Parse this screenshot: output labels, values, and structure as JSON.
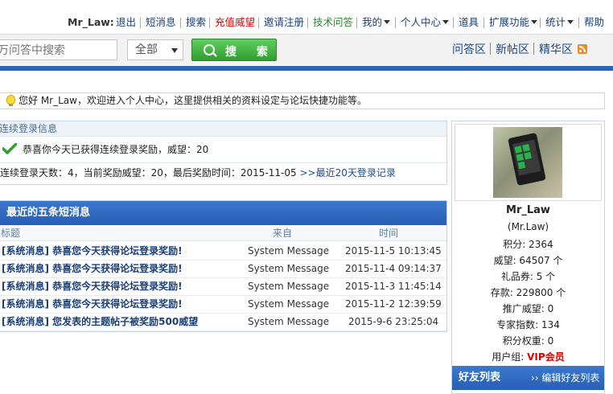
{
  "topnav": {
    "username": "Mr_Law:",
    "items": [
      {
        "label": "退出",
        "color": "#1a3f75"
      },
      {
        "label": "短消息",
        "color": "#1a3f75"
      },
      {
        "label": "搜索",
        "color": "#1a3f75"
      },
      {
        "label": "充值威望",
        "color": "#e00000"
      },
      {
        "label": "邀请注册",
        "color": "#1a3f75"
      },
      {
        "label": "技术问答",
        "color": "#2a8a2a"
      },
      {
        "label": "我的",
        "color": "#1a3f75"
      },
      {
        "label": "个人中心",
        "color": "#1a3f75"
      },
      {
        "label": "道具",
        "color": "#1a3f75"
      },
      {
        "label": "扩展功能",
        "color": "#1a3f75"
      },
      {
        "label": "统计",
        "color": "#1a3f75"
      },
      {
        "label": "帮助",
        "color": "#1a3f75"
      }
    ]
  },
  "search": {
    "placeholder": "万问答中搜索",
    "scope": "全部",
    "button": "搜 索"
  },
  "zones": [
    "问答区",
    "新帖区",
    "精华区"
  ],
  "welcome": "您好 Mr_Law，欢迎进入个人中心，这里提供相关的资料设定与论坛快捷功能等。",
  "login": {
    "title": "连续登录信息",
    "message": "恭喜你今天已获得连续登录奖励，威望：20",
    "stats": "连续登录天数：4，当前奖励威望：20，最后奖励时间：2015-11-05 ",
    "link": ">>最近20天登录记录"
  },
  "messages": {
    "title": "最近的五条短消息",
    "columns": {
      "subject": "标题",
      "from": "来自",
      "time": "时间"
    },
    "rows": [
      {
        "subject": "[系统消息] 恭喜您今天获得论坛登录奖励!",
        "from": "System Message",
        "time": "2015-11-5 10:13:45"
      },
      {
        "subject": "[系统消息] 恭喜您今天获得论坛登录奖励!",
        "from": "System Message",
        "time": "2015-11-4 09:14:37"
      },
      {
        "subject": "[系统消息] 恭喜您今天获得论坛登录奖励!",
        "from": "System Message",
        "time": "2015-11-3 11:45:14"
      },
      {
        "subject": "[系统消息] 恭喜您今天获得论坛登录奖励!",
        "from": "System Message",
        "time": "2015-11-2 12:39:59"
      },
      {
        "subject": "[系统消息] 您发表的主题帖子被奖励500威望",
        "from": "System Message",
        "time": "2015-9-6 23:25:04"
      }
    ]
  },
  "profile": {
    "name": "Mr_Law",
    "nick": "(Mr.Law)",
    "points": "积分: 2364",
    "prestige": "威望: 64507 个",
    "coupons": "礼品券: 5 个",
    "deposit": "存款: 229800 个",
    "promo": "推广威望: 0",
    "expert": "专家指数: 134",
    "weight": "积分权重: 0",
    "group_label": "用户组: ",
    "group": "VIP会员"
  },
  "friends": {
    "title": "好友列表",
    "edit": "›› 编辑好友列表"
  }
}
